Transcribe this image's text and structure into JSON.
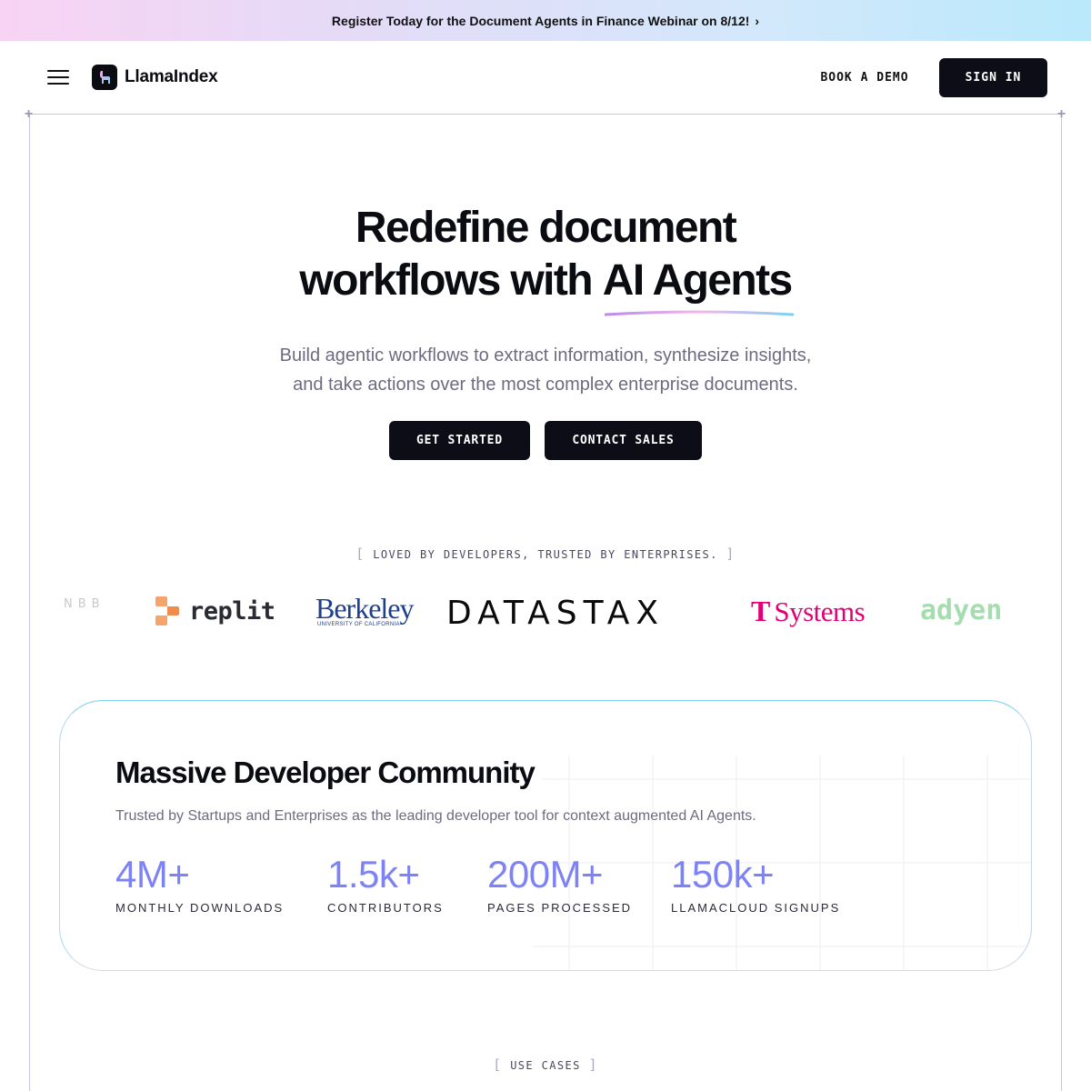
{
  "banner": {
    "text": "Register Today for the Document Agents in Finance Webinar on 8/12!",
    "chevron": "›"
  },
  "header": {
    "logo_text": "LlamaIndex",
    "book_demo": "BOOK A DEMO",
    "sign_in": "SIGN IN"
  },
  "hero": {
    "title_line1": "Redefine document",
    "title_line2_prefix": "workflows with ",
    "title_line2_accent": "AI Agents",
    "subtitle_line1": "Build agentic workflows to extract information, synthesize insights,",
    "subtitle_line2": "and take actions over the most complex enterprise documents.",
    "get_started": "GET STARTED",
    "contact_sales": "CONTACT SALES"
  },
  "trusted": {
    "eyebrow": "LOVED BY DEVELOPERS, TRUSTED BY ENTERPRISES.",
    "logos": {
      "nbb": "NBB",
      "replit": "replit",
      "berkeley": "Berkeley",
      "berkeley_sub": "UNIVERSITY OF CALIFORNIA",
      "datastax": "DATASTAX",
      "tsystems_t": "T",
      "tsystems": "Systems",
      "adyen": "adyen"
    }
  },
  "community": {
    "title": "Massive Developer Community",
    "subtitle": "Trusted by Startups and Enterprises as the leading developer tool for context augmented AI Agents.",
    "stats": [
      {
        "value": "4M+",
        "label": "MONTHLY DOWNLOADS"
      },
      {
        "value": "1.5k+",
        "label": "CONTRIBUTORS"
      },
      {
        "value": "200M+",
        "label": "PAGES PROCESSED"
      },
      {
        "value": "150k+",
        "label": "LLAMACLOUD SIGNUPS"
      }
    ]
  },
  "use_cases": {
    "eyebrow": "USE CASES"
  },
  "colors": {
    "accent_stat": "#7d83f5",
    "button_bg": "#0d0d17",
    "tsystems": "#e20074",
    "berkeley": "#1d3f8c"
  }
}
